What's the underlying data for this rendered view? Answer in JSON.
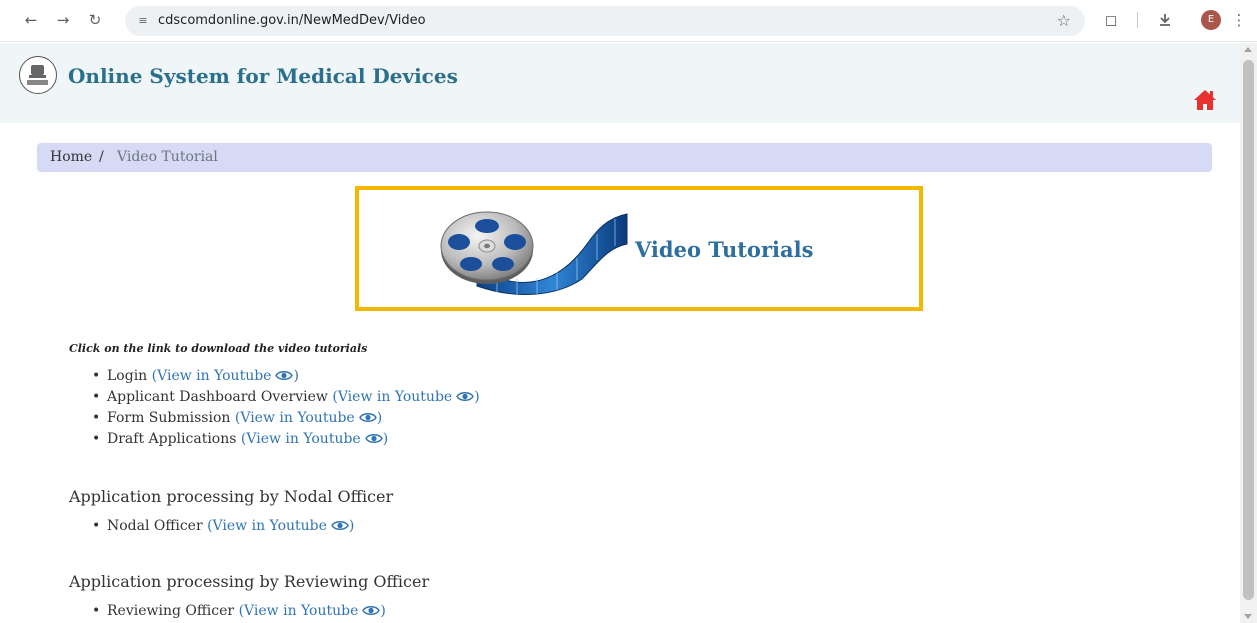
{
  "browser": {
    "url": "cdscomdonline.gov.in/NewMedDev/Video",
    "profile_initial": "E"
  },
  "header": {
    "title": "Online System for Medical Devices"
  },
  "breadcrumb": {
    "home": "Home",
    "separator": "/",
    "current": "Video Tutorial"
  },
  "banner": {
    "title": "Video Tutorials"
  },
  "content": {
    "instruction": "Click on the link to download the video tutorials",
    "applicant_items": [
      {
        "label": "Login",
        "link": "(View in Youtube",
        "close": ")"
      },
      {
        "label": "Applicant Dashboard Overview",
        "link": "(View in Youtube",
        "close": ")"
      },
      {
        "label": "Form Submission",
        "link": "(View in Youtube",
        "close": ")"
      },
      {
        "label": "Draft Applications",
        "link": "(View in Youtube",
        "close": ")"
      }
    ],
    "sections": [
      {
        "heading": "Application processing by Nodal Officer",
        "items": [
          {
            "label": "Nodal Officer",
            "link": "(View in Youtube",
            "close": ")"
          }
        ]
      },
      {
        "heading": "Application processing by Reviewing Officer",
        "items": [
          {
            "label": "Reviewing Officer",
            "link": "(View in Youtube",
            "close": ")"
          }
        ]
      }
    ]
  },
  "colors": {
    "header_bg": "#f0f6f7",
    "title": "#2a6f8b",
    "link": "#2f74b4",
    "banner_border": "#f5b800",
    "breadcrumb_bg": "#d6daf5",
    "home_icon": "#e8312f"
  }
}
